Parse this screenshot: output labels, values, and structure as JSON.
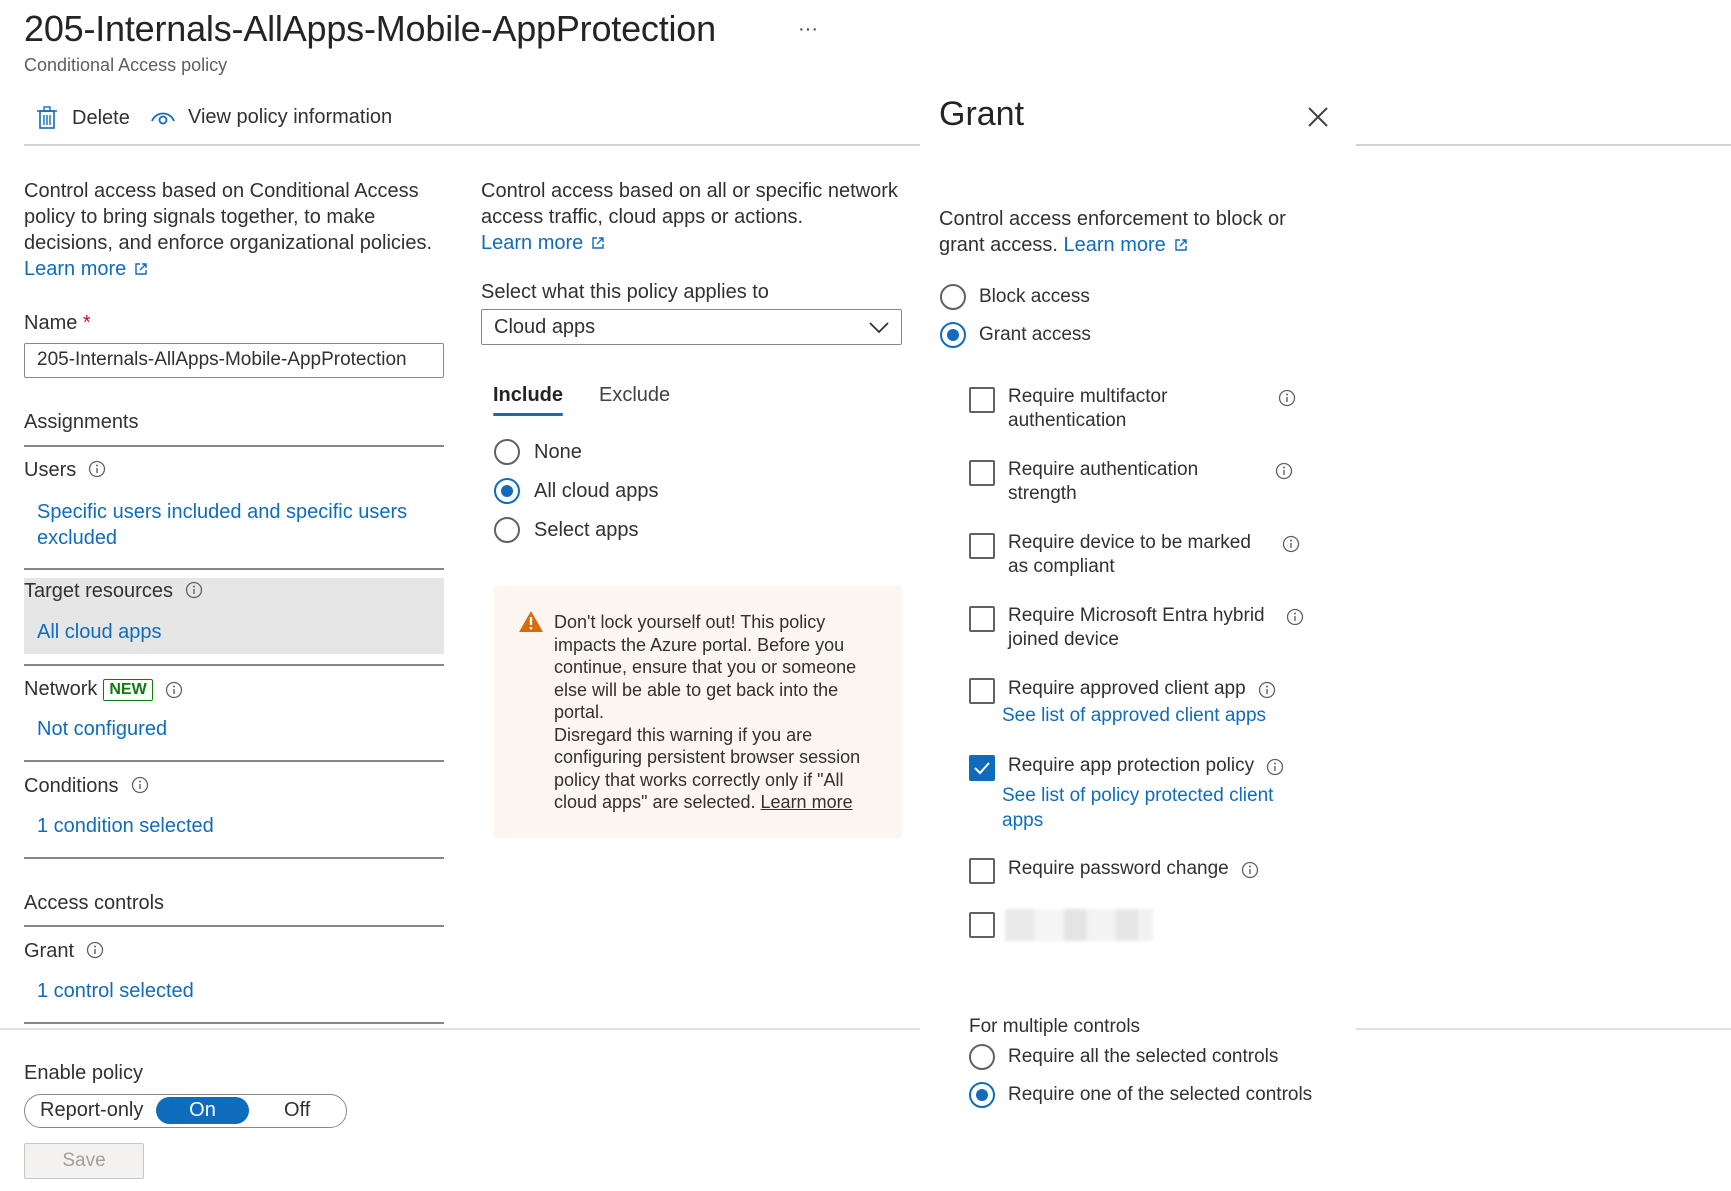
{
  "header": {
    "title": "205-Internals-AllApps-Mobile-AppProtection",
    "more": "···",
    "subtitle": "Conditional Access policy"
  },
  "toolbar": {
    "delete_label": "Delete",
    "view_info_label": "View policy information"
  },
  "left": {
    "description": "Control access based on Conditional Access policy to bring signals together, to make decisions, and enforce organizational policies.",
    "learn_more": "Learn more",
    "name_label": "Name",
    "required_mark": "*",
    "name_value": "205-Internals-AllApps-Mobile-AppProtection",
    "assignments_heading": "Assignments",
    "users_label": "Users",
    "users_value": "Specific users included and specific users excluded",
    "target_label": "Target resources",
    "target_value": "All cloud apps",
    "network_label": "Network",
    "network_badge": "NEW",
    "network_value": "Not configured",
    "conditions_label": "Conditions",
    "conditions_value": "1 condition selected",
    "access_heading": "Access controls",
    "grant_label": "Grant",
    "grant_value": "1 control selected",
    "enable_heading": "Enable policy",
    "toggle": [
      "Report-only",
      "On",
      "Off"
    ],
    "save_label": "Save"
  },
  "middle": {
    "description": "Control access based on all or specific network access traffic, cloud apps or actions.",
    "learn_more": "Learn more",
    "select_label": "Select what this policy applies to",
    "select_value": "Cloud apps",
    "tabs": [
      "Include",
      "Exclude"
    ],
    "options": [
      {
        "label": "None",
        "selected": false
      },
      {
        "label": "All cloud apps",
        "selected": true
      },
      {
        "label": "Select apps",
        "selected": false
      }
    ],
    "warning_1": "Don't lock yourself out! This policy impacts the Azure portal. Before you continue, ensure that you or someone else will be able to get back into the portal.",
    "warning_2": "Disregard this warning if you are configuring persistent browser session policy that works correctly only if \"All cloud apps\" are selected.",
    "warning_link": "Learn more"
  },
  "grant": {
    "title": "Grant",
    "description": "Control access enforcement to block or grant access.",
    "learn_more": "Learn more",
    "block_label": "Block access",
    "grant_label": "Grant access",
    "controls": [
      {
        "l1": "Require multifactor",
        "l2": "authentication",
        "checked": false
      },
      {
        "l1": "Require authentication",
        "l2": "strength",
        "checked": false
      },
      {
        "l1": "Require device to be marked",
        "l2": "as compliant",
        "checked": false
      },
      {
        "l1": "Require Microsoft Entra hybrid",
        "l2": "joined device",
        "checked": false
      },
      {
        "l1": "Require approved client app",
        "link": "See list of approved client apps",
        "checked": false
      },
      {
        "l1": "Require app protection policy",
        "link": "See list of policy protected client",
        "link2": "apps",
        "checked": true
      },
      {
        "l1": "Require password change",
        "checked": false
      }
    ],
    "multi_heading": "For multiple controls",
    "multi_all": "Require all the selected controls",
    "multi_one": "Require one of the selected controls"
  },
  "colors": {
    "accent": "#0f6cbd",
    "warning": "#d86b0c",
    "badge": "#107c10"
  }
}
